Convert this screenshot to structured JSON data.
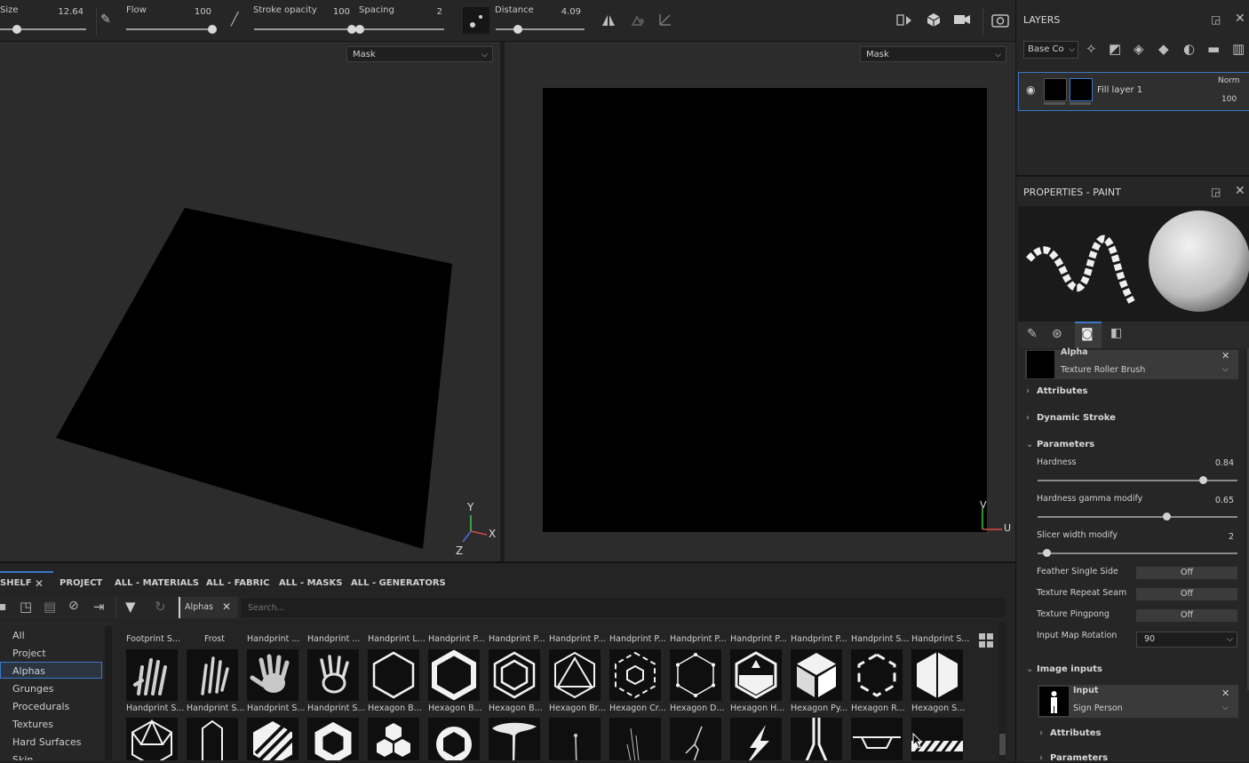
{
  "toolbar": {
    "size_label": "Size",
    "size_value": "12.64",
    "size_fill": 0.2,
    "flow_label": "Flow",
    "flow_value": "100",
    "flow_fill": 1.0,
    "stroke_opacity_label": "Stroke opacity",
    "stroke_opacity_value": "100",
    "stroke_opacity_fill": 1.0,
    "spacing_label": "Spacing",
    "spacing_value": "2",
    "spacing_fill": 0.0,
    "distance_label": "Distance",
    "distance_value": "4.09",
    "distance_fill": 0.25
  },
  "viewport_3d": {
    "channel": "Mask",
    "axis_y": "Y",
    "axis_x": "X",
    "axis_z": "Z"
  },
  "viewport_2d": {
    "channel": "Mask",
    "axis_v": "V",
    "axis_u": "U"
  },
  "layers": {
    "title": "LAYERS",
    "channel_select": "Base Co",
    "layer_name": "Fill layer 1",
    "blend_mode": "Norm",
    "opacity": "100"
  },
  "properties": {
    "title": "PROPERTIES - PAINT",
    "alpha_title": "Alpha",
    "alpha_name": "Texture Roller Brush",
    "attributes": "Attributes",
    "dynamic_stroke": "Dynamic Stroke",
    "parameters": "Parameters",
    "hardness_label": "Hardness",
    "hardness_value": "0.84",
    "hardness_fill": 0.83,
    "gamma_label": "Hardness gamma modify",
    "gamma_value": "0.65",
    "gamma_fill": 0.65,
    "slicer_label": "Slicer width modify",
    "slicer_value": "2",
    "slicer_fill": 0.05,
    "feather_label": "Feather Single Side",
    "feather_value": "Off",
    "repeat_label": "Texture Repeat Seam",
    "repeat_value": "Off",
    "pingpong_label": "Texture Pingpong",
    "pingpong_value": "Off",
    "rotation_label": "Input Map Rotation",
    "rotation_value": "90",
    "image_inputs": "Image inputs",
    "input_title": "Input",
    "input_name": "Sign Person",
    "input_attributes": "Attributes",
    "input_parameters": "Parameters"
  },
  "shelf": {
    "tabs": [
      "SHELF",
      "PROJECT",
      "ALL - MATERIALS",
      "ALL - FABRIC",
      "ALL - MASKS",
      "ALL - GENERATORS"
    ],
    "filter_chip": "Alphas",
    "search_placeholder": "Search...",
    "categories": [
      "All",
      "Project",
      "Alphas",
      "Grunges",
      "Procedurals",
      "Textures",
      "Hard Surfaces",
      "Skin"
    ],
    "selected_category": "Alphas",
    "row0_labels": [
      "Footprint S...",
      "Frost",
      "Handprint ...",
      "Handprint ...",
      "Handprint L...",
      "Handprint P...",
      "Handprint P...",
      "Handprint P...",
      "Handprint P...",
      "Handprint P...",
      "Handprint P...",
      "Handprint P...",
      "Handprint S...",
      "Handprint S..."
    ],
    "row1_labels": [
      "Handprint S...",
      "Handprint S...",
      "Handprint S...",
      "Handprint S...",
      "Hexagon B...",
      "Hexagon B...",
      "Hexagon B...",
      "Hexagon Br...",
      "Hexagon Cr...",
      "Hexagon D...",
      "Hexagon H...",
      "Hexagon Py...",
      "Hexagon R...",
      "Hexagon S..."
    ]
  }
}
